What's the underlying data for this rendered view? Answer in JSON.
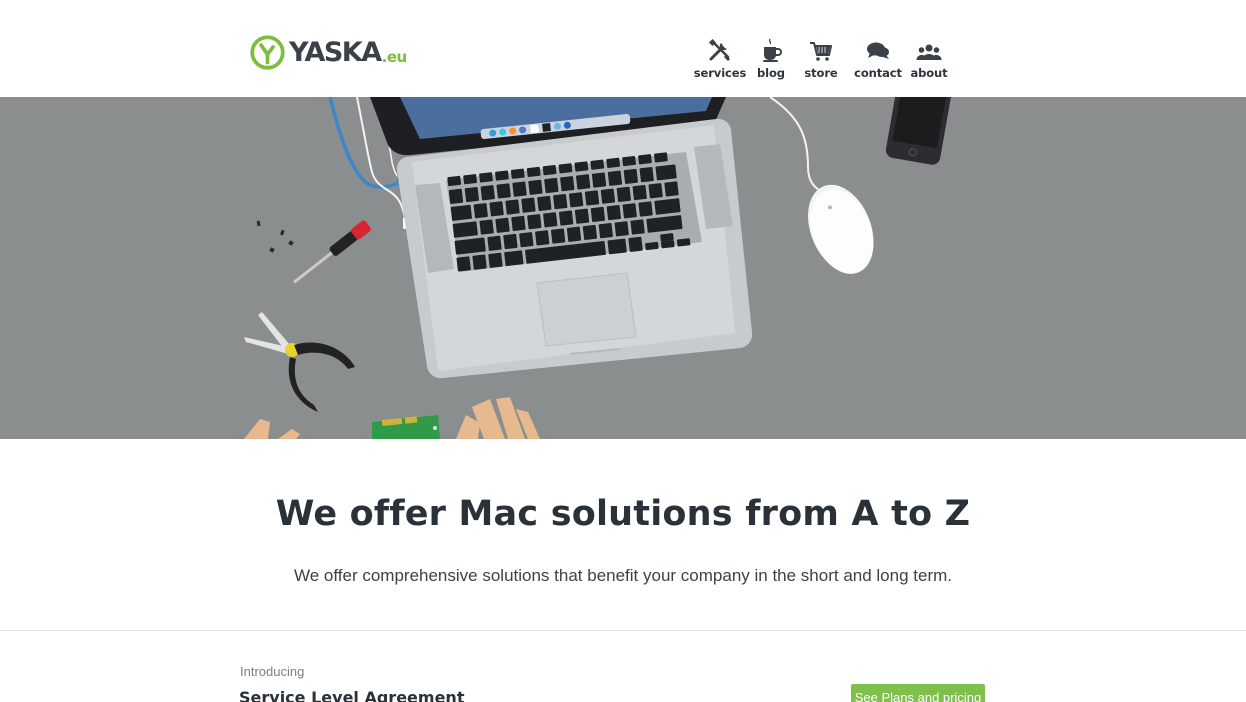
{
  "brand": {
    "name": "YASKA",
    "tld": ".eu",
    "accent_color": "#7cbd3c",
    "text_color": "#3a4148"
  },
  "nav": {
    "items": [
      {
        "label": "services",
        "icon": "tools-icon"
      },
      {
        "label": "blog",
        "icon": "coffee-cup-icon"
      },
      {
        "label": "store",
        "icon": "cart-icon"
      },
      {
        "label": "contact",
        "icon": "chat-bubbles-icon"
      },
      {
        "label": "about",
        "icon": "people-icon"
      }
    ]
  },
  "hero": {
    "background": "#8b8e8f",
    "illustration": "macbook-repair-desk"
  },
  "main": {
    "headline": "We offer Mac solutions from A to Z",
    "subline": "We offer comprehensive solutions that benefit your company in the short and long term."
  },
  "sla": {
    "intro": "Introducing",
    "title": "Service Level Agreement",
    "cta_label": "See Plans and pricing",
    "cta_color": "#7fc04a"
  }
}
